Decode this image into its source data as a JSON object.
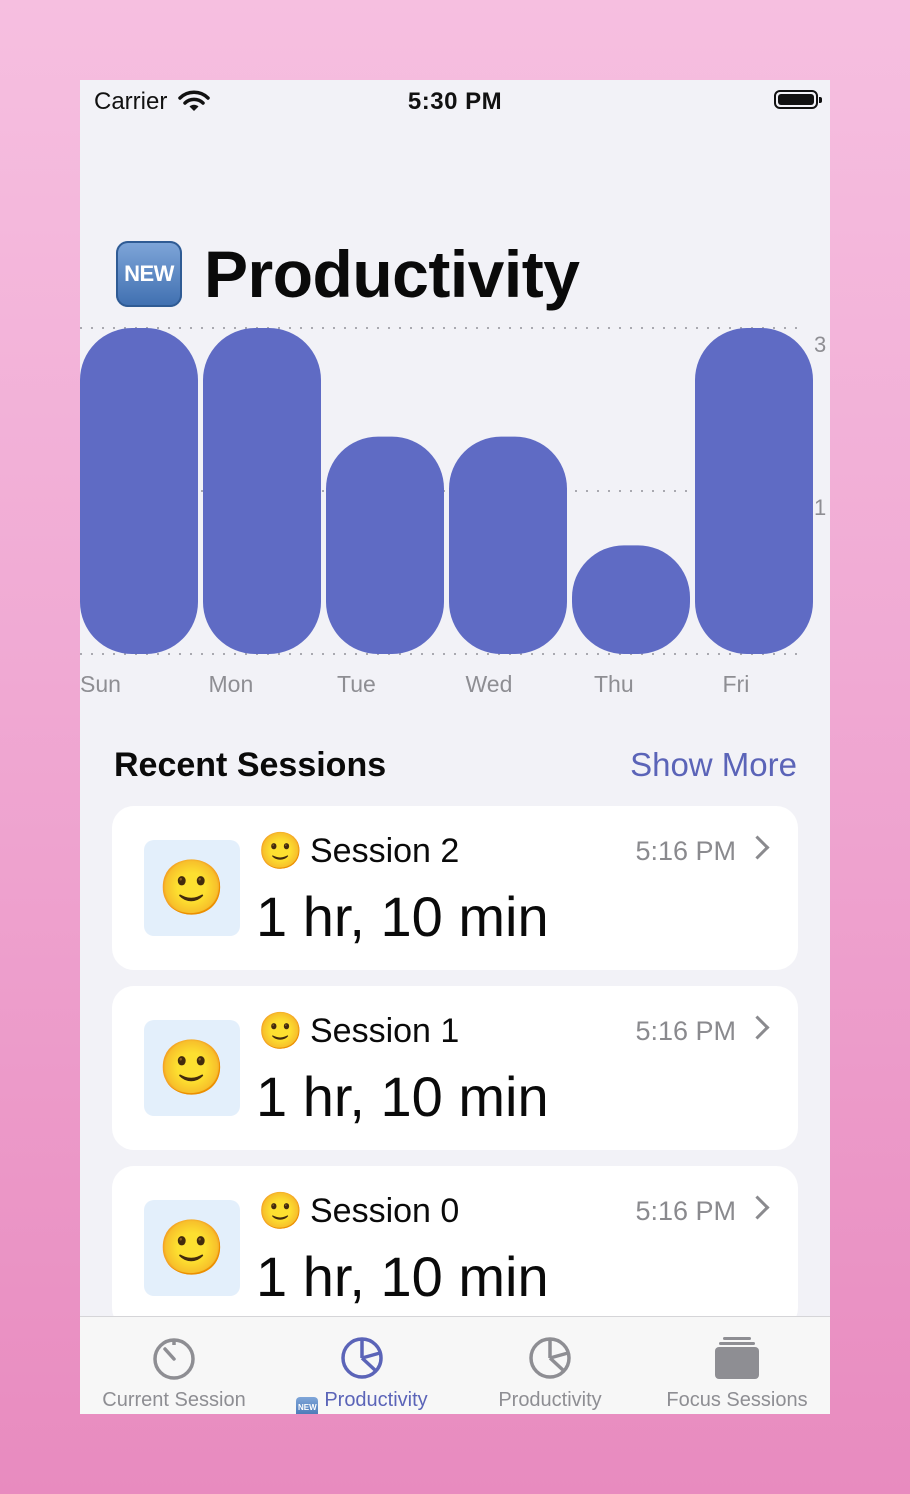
{
  "status_bar": {
    "carrier": "Carrier",
    "time": "5:30 PM"
  },
  "header": {
    "badge": "NEW",
    "title": "Productivity"
  },
  "chart_data": {
    "type": "bar",
    "categories": [
      "Sun",
      "Mon",
      "Tue",
      "Wed",
      "Thu",
      "Fri"
    ],
    "values": [
      3,
      3,
      2,
      2,
      1,
      3
    ],
    "y_ticks": [
      "3",
      "1"
    ],
    "ylim": [
      0,
      3
    ],
    "grid": true,
    "bar_color": "#5f6bc4"
  },
  "recent": {
    "title": "Recent Sessions",
    "show_more": "Show More",
    "sessions": [
      {
        "icon": "🙂",
        "name": "Session 2",
        "time": "5:16 PM",
        "duration": "1 hr, 10 min"
      },
      {
        "icon": "🙂",
        "name": "Session 1",
        "time": "5:16 PM",
        "duration": "1 hr, 10 min"
      },
      {
        "icon": "🙂",
        "name": "Session 0",
        "time": "5:16 PM",
        "duration": "1 hr, 10 min"
      }
    ]
  },
  "tabs": [
    {
      "label": "Current Session",
      "icon": "timer-icon"
    },
    {
      "label": "Productivity",
      "badge": "NEW",
      "icon": "pie-chart-icon",
      "active": true
    },
    {
      "label": "Productivity",
      "icon": "pie-chart-icon"
    },
    {
      "label": "Focus Sessions",
      "icon": "stack-icon"
    }
  ],
  "colors": {
    "accent": "#5b64b8",
    "bar": "#5f6bc4",
    "background": "#f2f2f7"
  }
}
